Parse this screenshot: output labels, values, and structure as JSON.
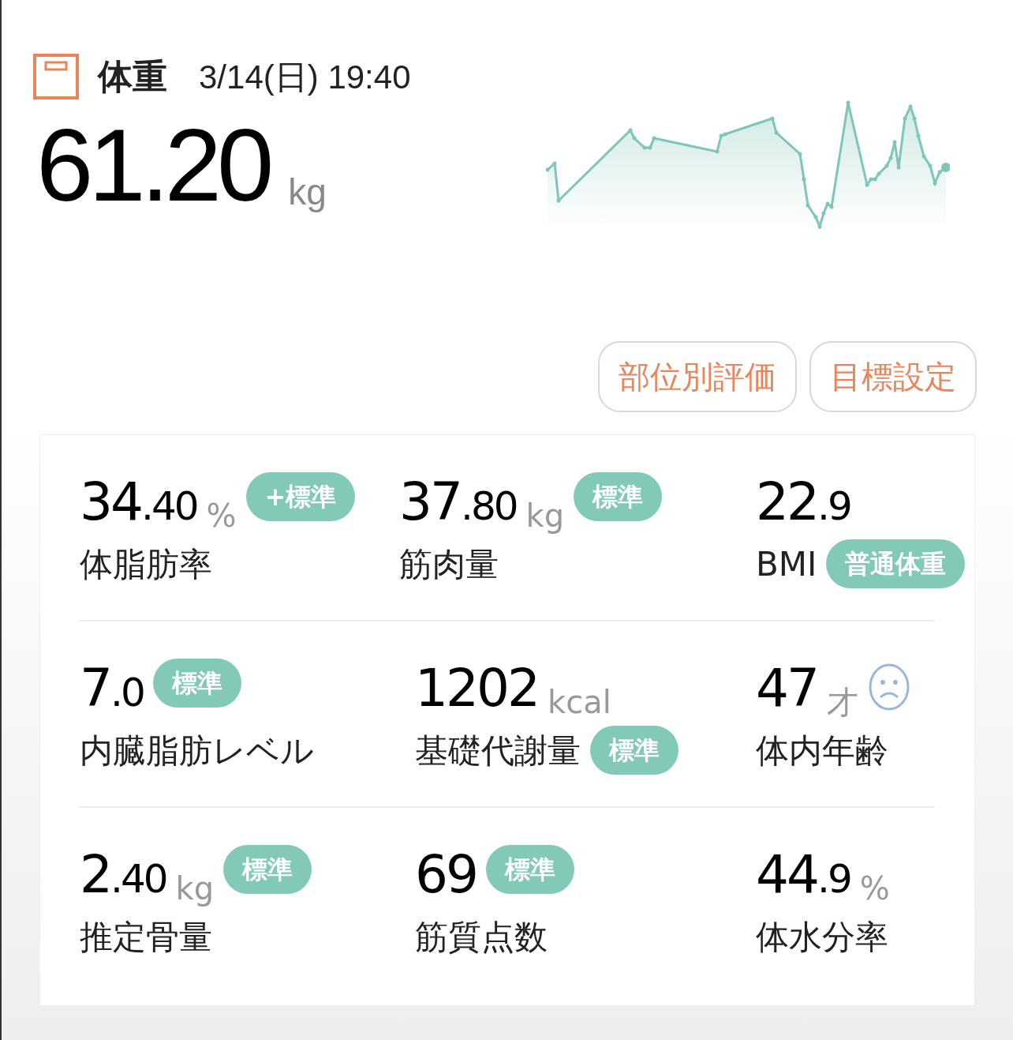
{
  "header": {
    "title": "体重",
    "datetime": "3/14(日) 19:40"
  },
  "weight": {
    "value": "61.20",
    "unit": "kg"
  },
  "buttons": [
    "部位別評価",
    "目標設定"
  ],
  "rows": [
    [
      {
        "kind": "tagged",
        "int": "34",
        "dec": ".40",
        "unit": "%",
        "label": "体脂肪率",
        "badge": "+標準"
      },
      {
        "kind": "tagged",
        "int": "37",
        "dec": ".80",
        "unit": "kg",
        "label": "筋肉量",
        "badge": "標準"
      },
      {
        "kind": "labeltagged",
        "int": "22",
        "dec": ".9",
        "label": "BMI",
        "badge": "普通体重"
      }
    ],
    [
      {
        "kind": "tagged",
        "int": "7",
        "dec": ".0",
        "label": "内臓脂肪レベル",
        "badge": "標準"
      },
      {
        "kind": "labeltagged",
        "int": "1202",
        "unit": "kcal",
        "label": "基礎代謝量",
        "badge": "標準"
      },
      {
        "kind": "face",
        "int": "47",
        "unit": "才",
        "label": "体内年齢"
      }
    ],
    [
      {
        "kind": "tagged",
        "int": "2",
        "dec": ".40",
        "unit": "kg",
        "label": "推定骨量",
        "badge": "標準"
      },
      {
        "kind": "tagged",
        "int": "69",
        "label": "筋質点数",
        "badge": "標準"
      },
      {
        "kind": "plain",
        "int": "44",
        "dec": ".9",
        "unit": "%",
        "label": "体水分率"
      }
    ]
  ]
}
